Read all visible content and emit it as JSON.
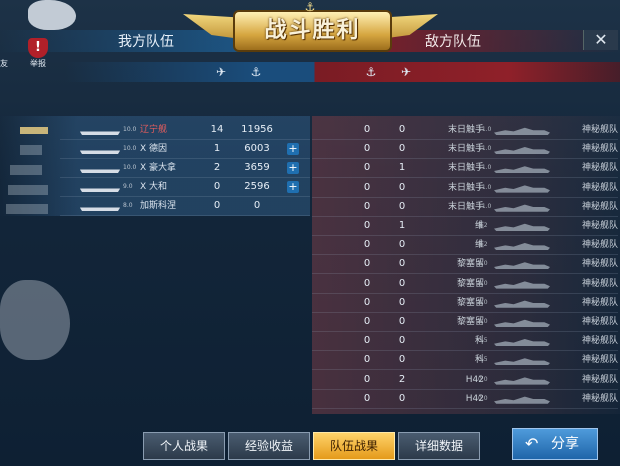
{
  "header": {
    "title": "战斗胜利",
    "our_team": "我方队伍",
    "enemy_team": "敌方队伍",
    "close": "✕"
  },
  "left_ui": {
    "report_icon": "!",
    "report_label": "举报",
    "friend_label": "友"
  },
  "icons": {
    "our_plane": "plane-icon",
    "our_ship": "ship-icon",
    "enemy_ship": "ship-icon",
    "enemy_plane": "plane-icon"
  },
  "our_rows": [
    {
      "level": "10.0",
      "name": "辽宁舰",
      "kills": "14",
      "score": "11956",
      "plus": ""
    },
    {
      "level": "10.0",
      "name": "X 德因",
      "kills": "1",
      "score": "6003",
      "plus": "+"
    },
    {
      "level": "10.0",
      "name": "X 豪大拿",
      "kills": "2",
      "score": "3659",
      "plus": "+"
    },
    {
      "level": "9.0",
      "name": "X 大和",
      "kills": "0",
      "score": "2596",
      "plus": "+"
    },
    {
      "level": "8.0",
      "name": "加斯科涅",
      "kills": "0",
      "score": "0",
      "plus": ""
    }
  ],
  "enemy_rows": [
    {
      "a": "0",
      "b": "0",
      "name": "末日触手",
      "level": "11.0",
      "team": "神秘舰队"
    },
    {
      "a": "0",
      "b": "0",
      "name": "末日触手",
      "level": "11.0",
      "team": "神秘舰队"
    },
    {
      "a": "0",
      "b": "1",
      "name": "末日触手",
      "level": "11.0",
      "team": "神秘舰队"
    },
    {
      "a": "0",
      "b": "0",
      "name": "末日触手",
      "level": "11.0",
      "team": "神秘舰队"
    },
    {
      "a": "0",
      "b": "0",
      "name": "末日触手",
      "level": "11.0",
      "team": "神秘舰队"
    },
    {
      "a": "0",
      "b": "1",
      "name": "维",
      "level": "8.2",
      "team": "神秘舰队"
    },
    {
      "a": "0",
      "b": "0",
      "name": "维",
      "level": "8.2",
      "team": "神秘舰队"
    },
    {
      "a": "0",
      "b": "0",
      "name": "黎塞留",
      "level": "8.0",
      "team": "神秘舰队"
    },
    {
      "a": "0",
      "b": "0",
      "name": "黎塞留",
      "level": "8.0",
      "team": "神秘舰队"
    },
    {
      "a": "0",
      "b": "0",
      "name": "黎塞留",
      "level": "8.0",
      "team": "神秘舰队"
    },
    {
      "a": "0",
      "b": "0",
      "name": "黎塞留",
      "level": "8.0",
      "team": "神秘舰队"
    },
    {
      "a": "0",
      "b": "0",
      "name": "科",
      "level": "0.5",
      "team": "神秘舰队"
    },
    {
      "a": "0",
      "b": "0",
      "name": "科",
      "level": "0.5",
      "team": "神秘舰队"
    },
    {
      "a": "0",
      "b": "2",
      "name": "H42",
      "level": "0.0",
      "team": "神秘舰队"
    },
    {
      "a": "0",
      "b": "0",
      "name": "H42",
      "level": "0.0",
      "team": "神秘舰队"
    }
  ],
  "tabs": [
    "个人战果",
    "经验收益",
    "队伍战果",
    "详细数据"
  ],
  "active_tab": "队伍战果",
  "share": {
    "label": "分享",
    "icon": "↶"
  }
}
